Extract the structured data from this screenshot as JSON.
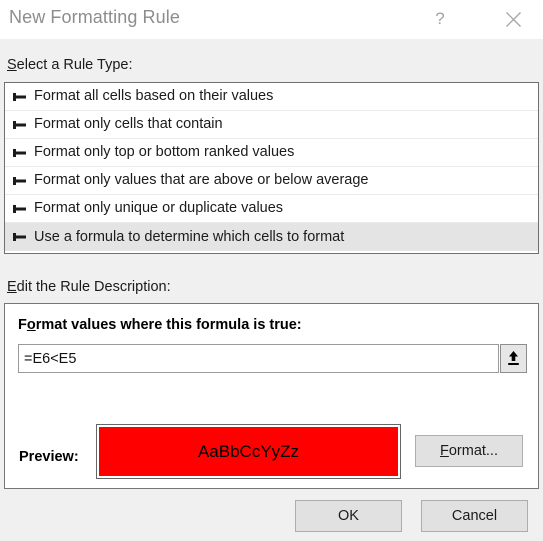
{
  "dialog": {
    "title": "New Formatting Rule",
    "help_icon": "question-mark-icon",
    "close_icon": "close-icon",
    "background_color": "#f0f0f0",
    "titlebar_color": "#ffffff",
    "title_text_color": "#8d8d8d"
  },
  "rule_type": {
    "label_accel": "S",
    "label_rest": "elect a Rule Type:",
    "items": [
      {
        "label": "Format all cells based on their values",
        "selected": false
      },
      {
        "label": "Format only cells that contain",
        "selected": false
      },
      {
        "label": "Format only top or bottom ranked values",
        "selected": false
      },
      {
        "label": "Format only values that are above or below average",
        "selected": false
      },
      {
        "label": "Format only unique or duplicate values",
        "selected": false
      },
      {
        "label": "Use a formula to determine which cells to format",
        "selected": true
      }
    ],
    "bullet_icon": "rule-type-bullet-icon",
    "selected_row_color": "#e4e4e4"
  },
  "rule_description": {
    "label_accel": "E",
    "label_rest": "dit the Rule Description:",
    "formula_heading_accel_pre": "F",
    "formula_heading_accel": "o",
    "formula_heading_rest": "rmat values where this formula is true:",
    "formula_value": "=E6<E5",
    "formula_placeholder": "",
    "range_selector_icon": "collapse-dialog-up-arrow-icon"
  },
  "preview": {
    "label": "Preview:",
    "sample_text": "AaBbCcYyZz",
    "fill_color": "#ff0000",
    "text_color": "#000000",
    "format_button_accel": "F",
    "format_button_rest": "ormat..."
  },
  "footer": {
    "ok_label": "OK",
    "cancel_label": "Cancel"
  }
}
